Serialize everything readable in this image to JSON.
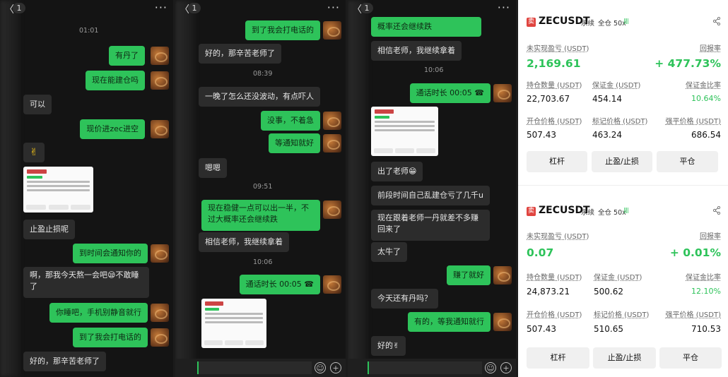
{
  "chat": {
    "badge": "1",
    "back_glyph": "〈",
    "more_glyph": "···",
    "panel1": {
      "time1": "01:01",
      "m1": "有丹了",
      "m2": "现在能建仓吗",
      "m3": "可以",
      "m4": "现价进zec进空",
      "m5": "✌",
      "m6": "止盈止损呢",
      "m7": "到时间会通知你的",
      "m8": "啊，那我今天熬一会吧😪不敢睡了",
      "m9": "你睡吧，手机别静音就行",
      "m10": "到了我会打电话的",
      "m11": "好的，那辛苦老师了"
    },
    "panel2": {
      "m1": "到了我会打电话的",
      "m2": "好的，那辛苦老师了",
      "time1": "08:39",
      "m3": "一晚了怎么还没波动，有点吓人",
      "m4": "没事，不着急",
      "m5": "等通知就好",
      "m6": "嗯嗯",
      "time2": "09:51",
      "m7": "现在稳健一点可以出一半，不过大概率还会继续跌",
      "m8": "相信老师，我继续拿着",
      "time3": "10:06",
      "m9": "通话时长 00:05 ☎"
    },
    "panel3": {
      "m1": "概率还会继续跌",
      "m2": "相信老师，我继续拿着",
      "time1": "10:06",
      "m3": "通话时长 00:05 ☎",
      "m4": "出了老师😁",
      "m5": "前段时间自己乱建仓亏了几千u",
      "m6": "现在跟着老师一丹就差不多赚回来了",
      "m7": "太牛了",
      "m8": "赚了就好",
      "m9": "今天还有丹吗？",
      "m10": "有的，等我通知就行",
      "m11": "好的✌"
    },
    "emoji_icon": "☺",
    "plus_icon": "+"
  },
  "trade": {
    "sell_tag": "卖",
    "bars_glyph": "||||",
    "labels": {
      "unrealized": "未实现盈亏 (USDT)",
      "roe": "回报率",
      "qty": "持仓数量 (USDT)",
      "margin": "保证金 (USDT)",
      "margin_ratio": "保证金比率",
      "entry": "开仓价格 (USDT)",
      "mark": "标记价格 (USDT)",
      "liq": "强平价格 (USDT)"
    },
    "buttons": {
      "leverage": "杠杆",
      "tpsl": "止盈/止损",
      "close": "平仓"
    },
    "card1": {
      "symbol": "ZECUSDT",
      "type": "永续",
      "mode": "全仓 50x",
      "pnl": "2,169.61",
      "roe": "+ 477.73%",
      "qty": "22,703.67",
      "margin": "454.14",
      "margin_ratio": "10.64%",
      "entry": "507.43",
      "mark": "463.24",
      "liq": "686.54"
    },
    "card2": {
      "symbol": "ZECUSDT",
      "type": "永续",
      "mode": "全仓 50x",
      "pnl": "0.07",
      "roe": "+ 0.01%",
      "qty": "24,873.21",
      "margin": "500.62",
      "margin_ratio": "12.10%",
      "entry": "507.43",
      "mark": "510.65",
      "liq": "710.53"
    }
  }
}
